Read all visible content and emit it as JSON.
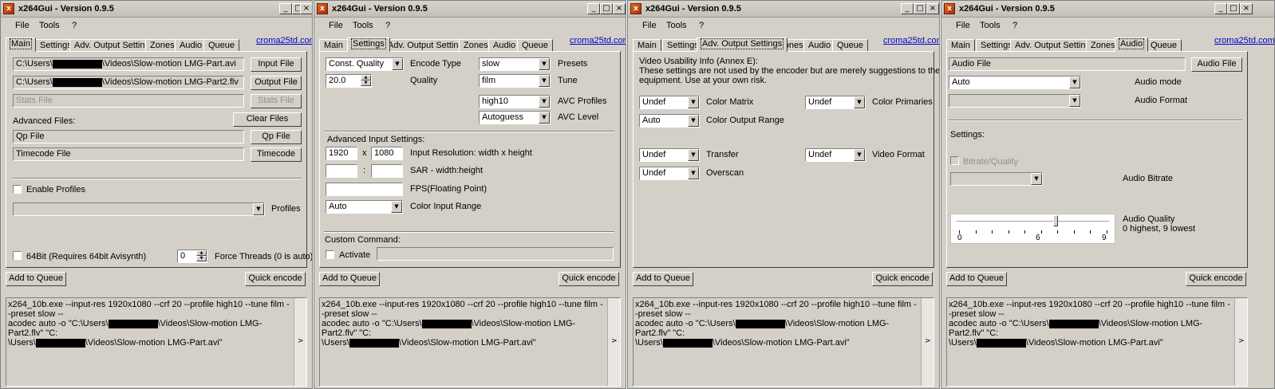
{
  "app_title": "x264Gui - Version 0.9.5",
  "menu": [
    "File",
    "Tools",
    "?"
  ],
  "tabs": [
    "Main",
    "Settings",
    "Adv. Output Settings",
    "Zones",
    "Audio",
    "Queue"
  ],
  "link": "croma25td.com",
  "window_buttons": {
    "minimize": "_",
    "maximize": "□",
    "close": "×"
  },
  "bottom": {
    "add_to_queue": "Add to Queue",
    "quick_encode": "Quick encode",
    "cmd_line1": "x264_10b.exe --input-res 1920x1080 --crf 20  --profile high10 --tune film --preset slow --",
    "cmd_line2a": "acodec auto  -o \"C:\\Users\\",
    "cmd_line2b": "\\Videos\\Slow-motion LMG-Part2.flv\"  \"C:",
    "cmd_line3a": "\\Users\\",
    "cmd_line3b": "\\Videos\\Slow-motion LMG-Part.avi\"",
    "scroll_arrow": ">"
  },
  "main": {
    "input_path_a": "C:\\Users\\",
    "input_path_b": "\\Videos\\Slow-motion LMG-Part.avi",
    "output_path_a": "C:\\Users\\",
    "output_path_b": "\\Videos\\Slow-motion LMG-Part2.flv",
    "input_file_btn": "Input File",
    "output_file_btn": "Output File",
    "stats_placeholder": "Stats File",
    "stats_btn": "Stats File",
    "advanced_files": "Advanced Files:",
    "clear_files_btn": "Clear Files",
    "qp_file_text": "Qp File",
    "qp_file_btn": "Qp File",
    "timecode_text": "Timecode File",
    "timecode_btn": "Timecode",
    "enable_profiles": "Enable Profiles",
    "profiles_label": "Profiles",
    "bit64": "64Bit (Requires 64bit Avisynth)",
    "threads_value": "0",
    "force_threads": "Force Threads (0 is auto)"
  },
  "settings": {
    "encode_type_value": "Const. Quality",
    "encode_type_label": "Encode Type",
    "quality_value": "20.0",
    "quality_label": "Quality",
    "presets_value": "slow",
    "presets_label": "Presets",
    "tune_value": "film",
    "tune_label": "Tune",
    "avc_profile_value": "high10",
    "avc_profile_label": "AVC Profiles",
    "avc_level_value": "Autoguess",
    "avc_level_label": "AVC Level",
    "adv_input_label": "Advanced Input Settings:",
    "width_value": "1920",
    "x_sep": "x",
    "height_value": "1080",
    "resolution_label": "Input Resolution: width x height",
    "sar_sep": ":",
    "sar_label": "SAR - width:height",
    "fps_label": "FPS(Floating Point)",
    "color_input_value": "Auto",
    "color_input_label": "Color Input Range",
    "custom_cmd_label": "Custom Command:",
    "activate_label": "Activate"
  },
  "adv": {
    "vui_title": "Video Usability Info (Annex E):",
    "vui_note1": "These settings are not used by the encoder but are merely suggestions to the playback",
    "vui_note2": "equipment. Use at your own risk.",
    "color_matrix_value": "Undef",
    "color_matrix_label": "Color Matrix",
    "color_primaries_value": "Undef",
    "color_primaries_label": "Color Primaries",
    "color_output_value": "Auto",
    "color_output_label": "Color Output Range",
    "transfer_value": "Undef",
    "transfer_label": "Transfer",
    "video_format_value": "Undef",
    "video_format_label": "Video Format",
    "overscan_value": "Undef",
    "overscan_label": "Overscan"
  },
  "audio": {
    "audio_file_text": "Audio File",
    "audio_file_btn": "Audio File",
    "audio_mode_value": "Auto",
    "audio_mode_label": "Audio mode",
    "audio_format_label": "Audio Format",
    "settings_label": "Settings:",
    "bitrate_quality_label": "Bitrate/Quality",
    "audio_bitrate_label": "Audio Bitrate",
    "audio_quality_label": "Audio Quality",
    "audio_quality_hint": "0 highest, 9 lowest",
    "slider_ticks": [
      "0",
      "6",
      "9"
    ],
    "slider_value": 0.65
  },
  "icons": {
    "app": "x264-app-icon",
    "dropdown": "dropdown-arrow-icon"
  }
}
